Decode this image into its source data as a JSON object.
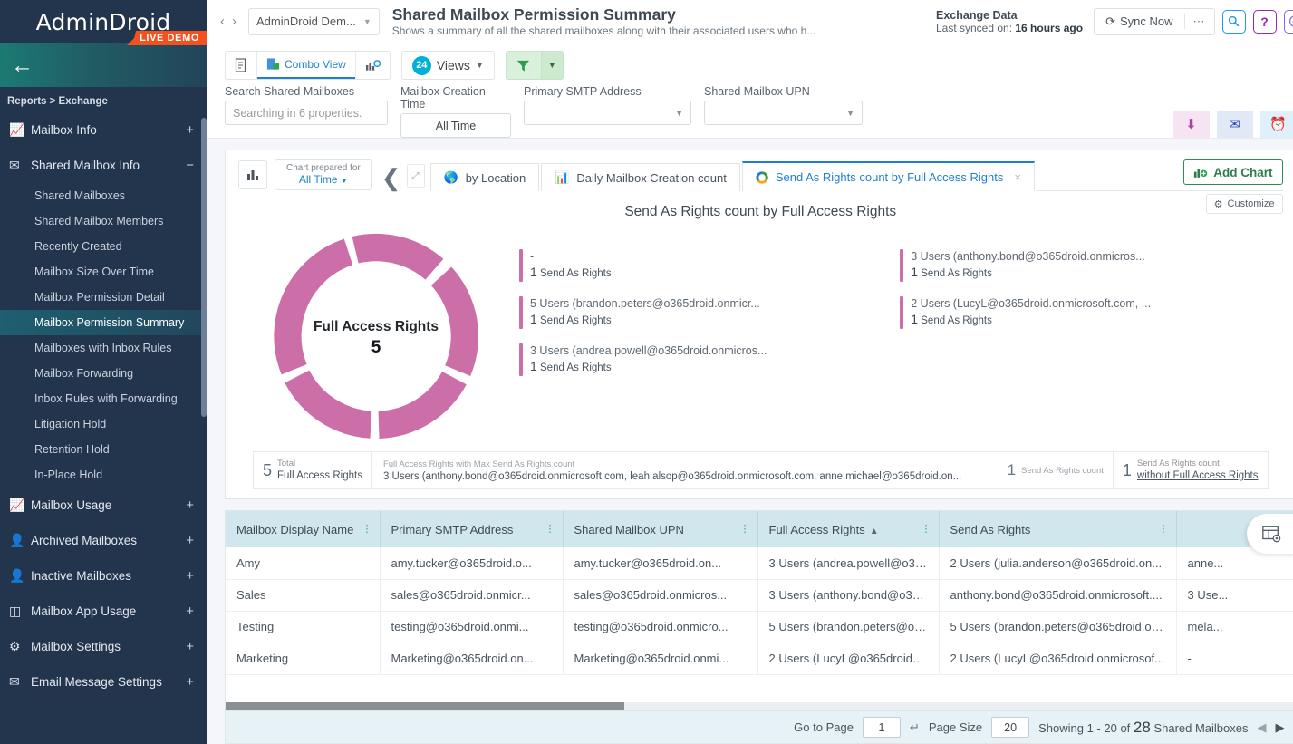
{
  "brand": {
    "name": "AdminDroid",
    "badge": "LIVE DEMO",
    "breadcrumb": "Reports > Exchange",
    "back_icon": "←"
  },
  "sidebar": {
    "groups": [
      {
        "icon": "📈",
        "label": "Mailbox Info",
        "toggle": "+"
      },
      {
        "icon": "✉",
        "label": "Shared Mailbox Info",
        "toggle": "−"
      }
    ],
    "sub_items": [
      "Shared Mailboxes",
      "Shared Mailbox Members",
      "Recently Created",
      "Mailbox Size Over Time",
      "Mailbox Permission Detail",
      "Mailbox Permission Summary",
      "Mailboxes with Inbox Rules",
      "Mailbox Forwarding",
      "Inbox Rules with Forwarding",
      "Litigation Hold",
      "Retention Hold",
      "In-Place Hold"
    ],
    "active_sub": "Mailbox Permission Summary",
    "lower_groups": [
      {
        "icon": "📈",
        "label": "Mailbox Usage",
        "toggle": "+"
      },
      {
        "icon": "👤",
        "label": "Archived Mailboxes",
        "toggle": "+"
      },
      {
        "icon": "👤",
        "label": "Inactive Mailboxes",
        "toggle": "+"
      },
      {
        "icon": "◱",
        "label": "Mailbox App Usage",
        "toggle": "+"
      },
      {
        "icon": "⚙",
        "label": "Mailbox Settings",
        "toggle": "+"
      },
      {
        "icon": "✉",
        "label": "Email Message Settings",
        "toggle": "+"
      }
    ]
  },
  "header": {
    "prev_arrow": "‹",
    "next_arrow": "›",
    "tenant": "AdminDroid Dem...",
    "title": "Shared Mailbox Permission Summary",
    "subtitle": "Shows a summary of all the shared mailboxes along with their associated users who h...",
    "sync_source": "Exchange Data",
    "sync_prefix": "Last synced on: ",
    "sync_value": "16 hours ago",
    "sync_button": "Sync Now",
    "sync_more": "⋯",
    "icon_search": "Q",
    "icon_help": "?",
    "icon_check": "✔"
  },
  "toolbar": {
    "tab_report": "report-icon",
    "tab_combo": "Combo View",
    "tab_chart": "chart-icon",
    "views_count": "24",
    "views_label": "Views",
    "filter_icon": "▼",
    "actions": {
      "download": "⬇",
      "email": "✉",
      "alarm": "⏰"
    },
    "filters": [
      {
        "label": "Search Shared Mailboxes",
        "value": "",
        "placeholder": "Searching in 6 properties.",
        "type": "text"
      },
      {
        "label": "Mailbox Creation Time",
        "value": "All Time",
        "type": "button"
      },
      {
        "label": "Primary SMTP Address",
        "value": "",
        "type": "select"
      },
      {
        "label": "Shared Mailbox UPN",
        "value": "",
        "type": "select"
      }
    ]
  },
  "chart_panel": {
    "prepared_for_line1": "Chart prepared for",
    "prepared_for_line2": "All Time",
    "tabs": [
      {
        "label": "by Location",
        "icon": "🌎",
        "active": false
      },
      {
        "label": "Daily Mailbox Creation count",
        "icon": "📊",
        "active": false
      },
      {
        "label": "Send As Rights count by Full Access Rights",
        "icon": "◯",
        "active": true,
        "close": "×"
      }
    ],
    "add_chart": "Add Chart",
    "customize": "Customize",
    "summary": {
      "total_number": "5",
      "total_label_1": "Total",
      "total_label_2": "Full Access Rights",
      "max_label": "Full Access Rights with Max Send As Rights count",
      "max_value": "3 Users (anthony.bond@o365droid.onmicrosoft.com, leah.alsop@o365droid.onmicrosoft.com, anne.michael@o365droid.on...",
      "max_count": "1",
      "max_count_label": "Send As Rights count",
      "without_number": "1",
      "without_label_1": "Send As Rights count",
      "without_label_2": "without Full Access Rights"
    }
  },
  "chart_data": {
    "type": "pie",
    "title": "Send As Rights count by Full Access Rights",
    "center_label": "Full Access Rights",
    "center_value": "5",
    "color": "#cc6fa8",
    "legend_position": "right",
    "categories": [
      "-",
      "5 Users (brandon.peters@o365droid.onmicr...",
      "3 Users (andrea.powell@o365droid.onmicros...",
      "3 Users (anthony.bond@o365droid.onmicros...",
      "2 Users (LucyL@o365droid.onmicrosoft.com, ..."
    ],
    "values": [
      1,
      1,
      1,
      1,
      1
    ],
    "value_suffix": "Send As Rights",
    "legend": [
      {
        "name": "-",
        "value": "1",
        "unit": "Send As Rights"
      },
      {
        "name": "5 Users (brandon.peters@o365droid.onmicr...",
        "value": "1",
        "unit": "Send As Rights"
      },
      {
        "name": "3 Users (andrea.powell@o365droid.onmicros...",
        "value": "1",
        "unit": "Send As Rights"
      },
      {
        "name": "3 Users (anthony.bond@o365droid.onmicros...",
        "value": "1",
        "unit": "Send As Rights"
      },
      {
        "name": "2 Users (LucyL@o365droid.onmicrosoft.com, ...",
        "value": "1",
        "unit": "Send As Rights"
      }
    ]
  },
  "table": {
    "columns": [
      {
        "label": "Mailbox Display Name",
        "sort": ""
      },
      {
        "label": "Primary SMTP Address",
        "sort": ""
      },
      {
        "label": "Shared Mailbox UPN",
        "sort": ""
      },
      {
        "label": "Full Access Rights",
        "sort": "▲"
      },
      {
        "label": "Send As Rights",
        "sort": ""
      },
      {
        "label": "",
        "sort": ""
      }
    ],
    "rows": [
      [
        "Amy",
        "amy.tucker@o365droid.o...",
        "amy.tucker@o365droid.on...",
        "3 Users (andrea.powell@o36...",
        "2 Users (julia.anderson@o365droid.on...",
        "anne..."
      ],
      [
        "Sales",
        "sales@o365droid.onmicr...",
        "sales@o365droid.onmicros...",
        "3 Users (anthony.bond@o36...",
        "anthony.bond@o365droid.onmicrosoft....",
        "3 Use..."
      ],
      [
        "Testing",
        "testing@o365droid.onmi...",
        "testing@o365droid.onmicro...",
        "5 Users (brandon.peters@o3...",
        "5 Users (brandon.peters@o365droid.on...",
        "mela..."
      ],
      [
        "Marketing",
        "Marketing@o365droid.on...",
        "Marketing@o365droid.onmi...",
        "2 Users (LucyL@o365droid.o...",
        "2 Users (LucyL@o365droid.onmicrosof...",
        "-"
      ]
    ],
    "column_settings_icon": "table-settings-icon"
  },
  "pagination": {
    "goto_label": "Go to Page",
    "goto_value": "1",
    "enter_icon": "↵",
    "pagesize_label": "Page Size",
    "pagesize_value": "20",
    "showing_prefix": "Showing 1 - 20 of ",
    "showing_count": "28",
    "showing_suffix": " Shared Mailboxes",
    "prev": "◀",
    "next": "▶"
  }
}
